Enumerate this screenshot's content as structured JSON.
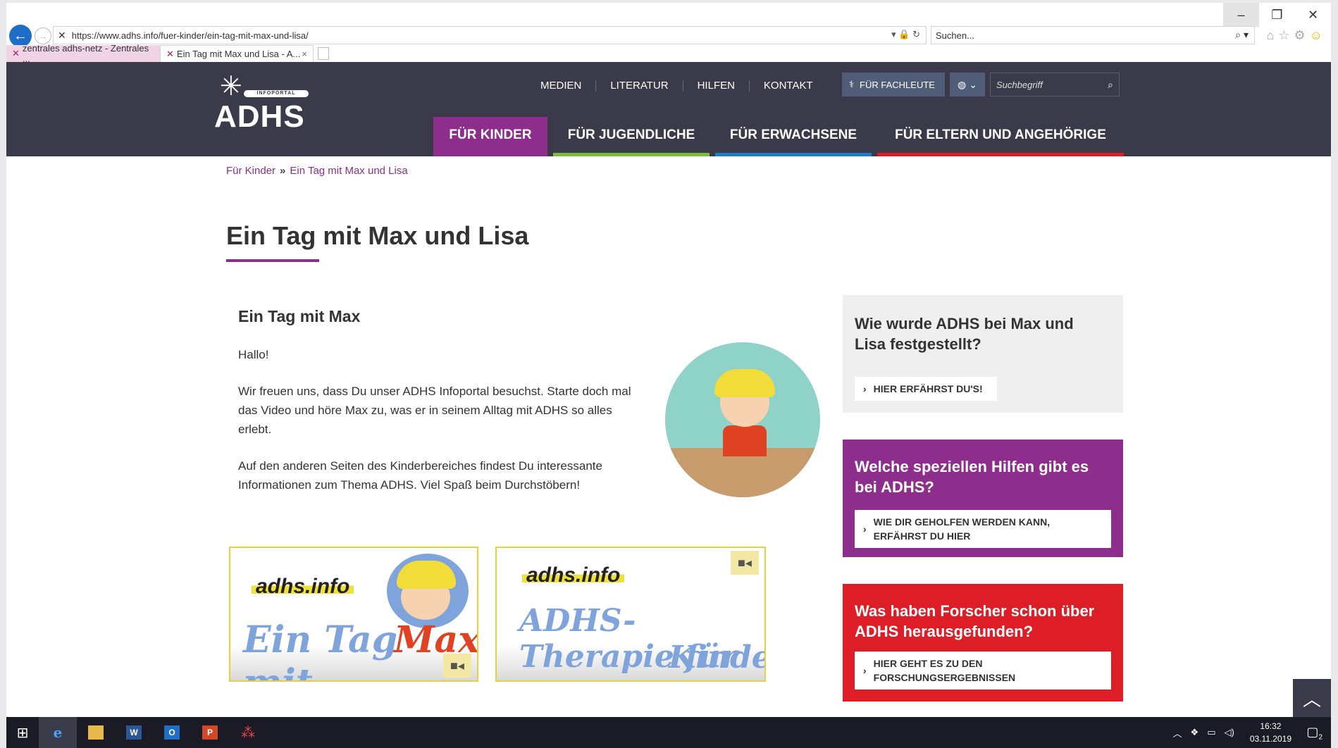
{
  "browser": {
    "url": "https://www.adhs.info/fuer-kinder/ein-tag-mit-max-und-lisa/",
    "search_placeholder": "Suchen...",
    "tabs": [
      {
        "label": "zentrales adhs-netz - Zentrales ..."
      },
      {
        "label": "Ein Tag mit Max und Lisa - A..."
      }
    ]
  },
  "site": {
    "logo_small": "INFOPORTAL",
    "logo_big": "ADHS",
    "topnav": [
      "MEDIEN",
      "LITERATUR",
      "HILFEN",
      "KONTAKT"
    ],
    "fachleute_label": "FÜR FACHLEUTE",
    "search_placeholder": "Suchbegriff",
    "mainnav": [
      "FÜR KINDER",
      "FÜR JUGENDLICHE",
      "FÜR ERWACHSENE",
      "FÜR ELTERN UND ANGEHÖRIGE"
    ],
    "colors": {
      "header": "#3b3a4a",
      "kinder": "#8e2e8c",
      "jugend": "#7cbd3c",
      "erwachsene": "#1c7cc8",
      "eltern": "#dd1e26"
    }
  },
  "breadcrumb": {
    "root": "Für Kinder",
    "current": "Ein Tag mit Max und Lisa"
  },
  "page": {
    "title": "Ein Tag mit Max und Lisa",
    "article_title": "Ein Tag mit Max",
    "greeting": "Hallo!",
    "para1": "Wir freuen uns, dass Du unser ADHS Infoportal besuchst. Starte doch mal das Video und höre Max zu, was er in seinem Alltag mit ADHS so alles erlebt.",
    "para2": "Auf den anderen Seiten des Kinderbereiches findest Du interessante Informationen zum Thema ADHS. Viel Spaß beim Durchstöbern!",
    "video1": {
      "logo": "adhs.info",
      "title_a": "Ein Tag mit",
      "title_b": "Max"
    },
    "video2": {
      "logo": "adhs.info",
      "title_a": "ADHS-Therapie für",
      "title_b": "Kinder"
    }
  },
  "sidebar": {
    "card1": {
      "title": "Wie wurde ADHS bei Max und Lisa festgestellt?",
      "button": "HIER ERFÄHRST DU'S!"
    },
    "card2": {
      "title": "Welche speziellen Hilfen gibt es bei ADHS?",
      "button": "WIE DIR GEHOLFEN WERDEN KANN, ERFÄHRST DU HIER"
    },
    "card3": {
      "title": "Was haben Forscher schon über ADHS herausgefunden?",
      "button": "HIER GEHT ES ZU DEN FORSCHUNGSERGEBNISSEN"
    }
  },
  "taskbar": {
    "time": "16:32",
    "date": "03.11.2019",
    "notifications": "2",
    "icons": [
      "windows-start",
      "internet-explorer",
      "file-explorer",
      "word",
      "outlook",
      "powerpoint",
      "app-red-dots"
    ]
  }
}
